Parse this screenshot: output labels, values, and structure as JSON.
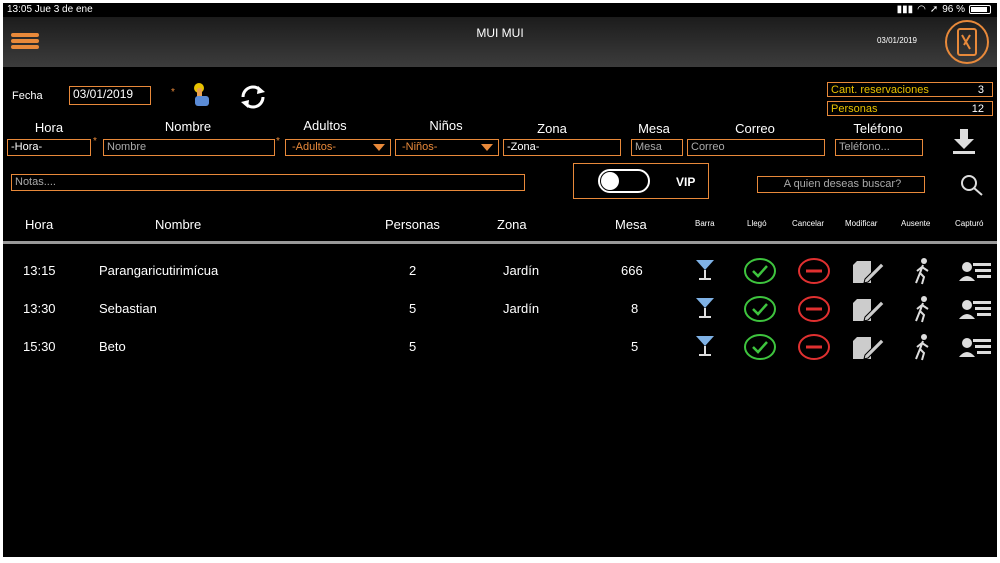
{
  "status_bar": {
    "time_day": "13:05  Jue 3 de ene",
    "battery": "96 %"
  },
  "header": {
    "title": "MUI MUI",
    "date": "03/01/2019"
  },
  "form": {
    "fecha_label": "Fecha",
    "fecha_value": "03/01/2019",
    "star": "*",
    "labels": {
      "hora": "Hora",
      "nombre": "Nombre",
      "adultos": "Adultos",
      "ninos": "Niños",
      "zona": "Zona",
      "mesa": "Mesa",
      "correo": "Correo",
      "telefono": "Teléfono"
    },
    "fields": {
      "hora": "-Hora-",
      "nombre": "Nombre",
      "adultos": "-Adultos-",
      "ninos": "-Niños-",
      "zona": "-Zona-",
      "mesa": "Mesa",
      "correo": "Correo",
      "telefono": "Teléfono...",
      "notas": "Notas...."
    },
    "vip_label": "VIP",
    "search_placeholder": "A quien deseas buscar?"
  },
  "summary": {
    "reservaciones_label": "Cant. reservaciones",
    "reservaciones_value": "3",
    "personas_label": "Personas",
    "personas_value": "12"
  },
  "table": {
    "headers": {
      "hora": "Hora",
      "nombre": "Nombre",
      "personas": "Personas",
      "zona": "Zona",
      "mesa": "Mesa",
      "barra": "Barra",
      "llego": "Llegó",
      "cancelar": "Cancelar",
      "modificar": "Modificar",
      "ausente": "Ausente",
      "capturo": "Capturó"
    },
    "rows": [
      {
        "hora": "13:15",
        "nombre": "Parangaricutirimícua",
        "personas": "2",
        "zona": "Jardín",
        "mesa": "666"
      },
      {
        "hora": "13:30",
        "nombre": "Sebastian",
        "personas": "5",
        "zona": "Jardín",
        "mesa": "8"
      },
      {
        "hora": "15:30",
        "nombre": "Beto",
        "personas": "5",
        "zona": "",
        "mesa": "5"
      }
    ]
  },
  "colors": {
    "accent": "#e8893a",
    "summary_text": "#e8c200",
    "ok_green": "#3ec43e",
    "cancel_red": "#e03030",
    "cocktail_blue": "#7fb2e6"
  }
}
